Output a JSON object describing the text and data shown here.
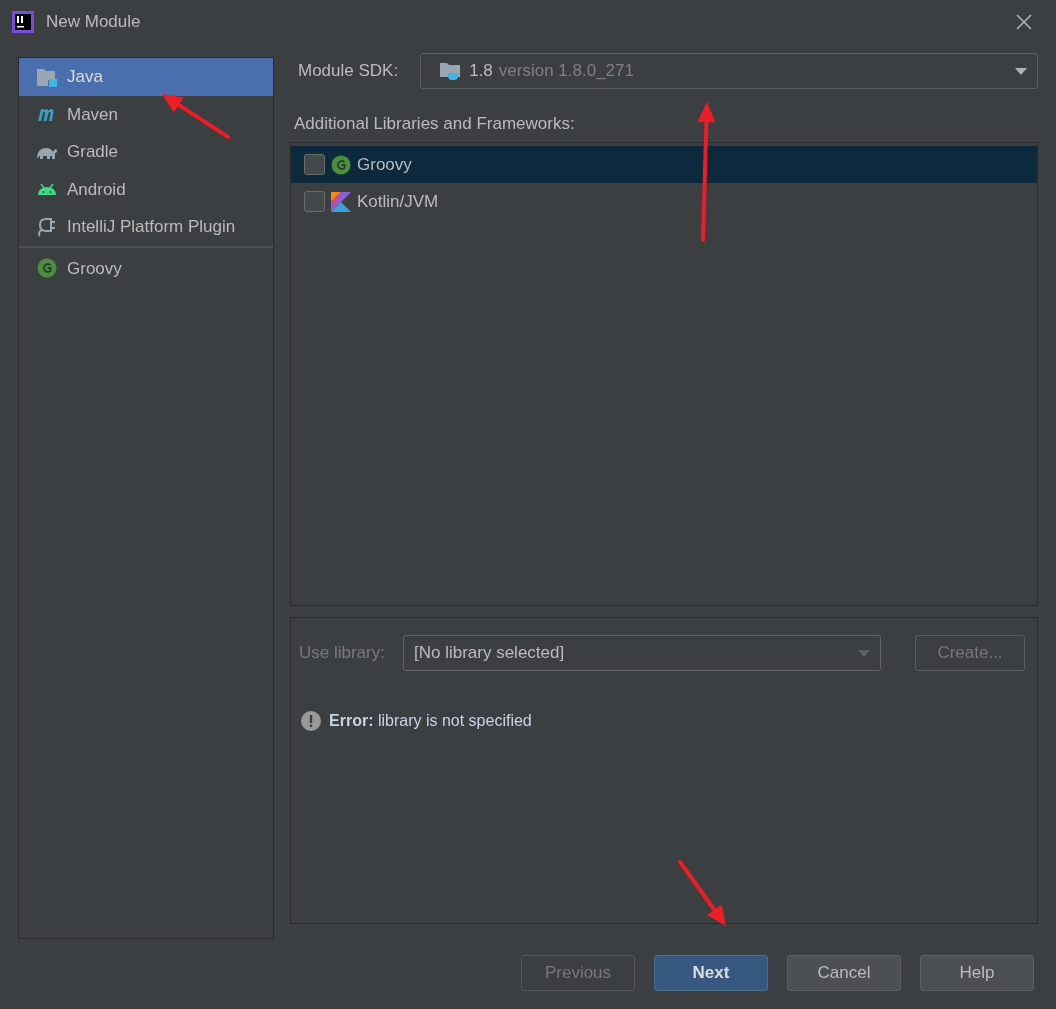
{
  "window": {
    "title": "New Module"
  },
  "sidebar": {
    "groups": [
      {
        "items": [
          {
            "label": "Java",
            "kind": "java",
            "selected": true
          },
          {
            "label": "Maven",
            "kind": "maven",
            "selected": false
          },
          {
            "label": "Gradle",
            "kind": "gradle",
            "selected": false
          },
          {
            "label": "Android",
            "kind": "android",
            "selected": false
          },
          {
            "label": "IntelliJ Platform Plugin",
            "kind": "plugin",
            "selected": false
          }
        ]
      },
      {
        "items": [
          {
            "label": "Groovy",
            "kind": "groovy",
            "selected": false
          }
        ]
      }
    ]
  },
  "module_sdk": {
    "label": "Module SDK:",
    "value": "1.8",
    "detail": "version 1.8.0_271"
  },
  "frameworks": {
    "label": "Additional Libraries and Frameworks:",
    "items": [
      {
        "label": "Groovy",
        "kind": "groovy",
        "checked": false,
        "selected": true
      },
      {
        "label": "Kotlin/JVM",
        "kind": "kotlin",
        "checked": false,
        "selected": false
      }
    ]
  },
  "library": {
    "label": "Use library:",
    "value": "[No library selected]",
    "create": "Create...",
    "disabled": true
  },
  "error": {
    "title": "Error:",
    "message": "library is not specified"
  },
  "buttons": [
    {
      "label": "Previous",
      "kind": "default",
      "disabled": true
    },
    {
      "label": "Next",
      "kind": "primary",
      "disabled": false
    },
    {
      "label": "Cancel",
      "kind": "default",
      "disabled": false
    },
    {
      "label": "Help",
      "kind": "default",
      "disabled": false
    }
  ],
  "annotations": [
    {
      "kind": "arrow"
    },
    {
      "kind": "arrow"
    },
    {
      "kind": "arrow"
    }
  ]
}
